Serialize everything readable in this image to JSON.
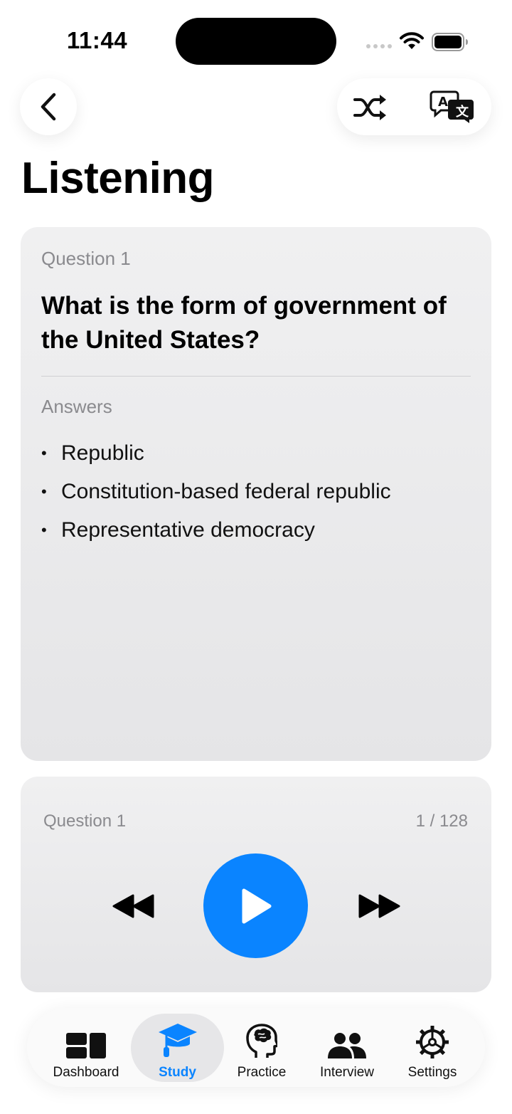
{
  "status_bar": {
    "time": "11:44"
  },
  "header": {
    "title": "Listening"
  },
  "question_card": {
    "label": "Question 1",
    "question": "What is the form of government of the United States?",
    "answers_label": "Answers",
    "answers": [
      "Republic",
      "Constitution-based federal republic",
      "Representative democracy"
    ]
  },
  "player": {
    "label": "Question 1",
    "count": "1 / 128"
  },
  "tabs": [
    {
      "label": "Dashboard",
      "icon": "dashboard-icon",
      "active": false
    },
    {
      "label": "Study",
      "icon": "graduation-cap-icon",
      "active": true
    },
    {
      "label": "Practice",
      "icon": "brain-head-icon",
      "active": false
    },
    {
      "label": "Interview",
      "icon": "people-icon",
      "active": false
    },
    {
      "label": "Settings",
      "icon": "gear-icon",
      "active": false
    }
  ],
  "colors": {
    "accent": "#0a84ff",
    "card_bg": "#ececee",
    "secondary_text": "#8a8a8e"
  }
}
